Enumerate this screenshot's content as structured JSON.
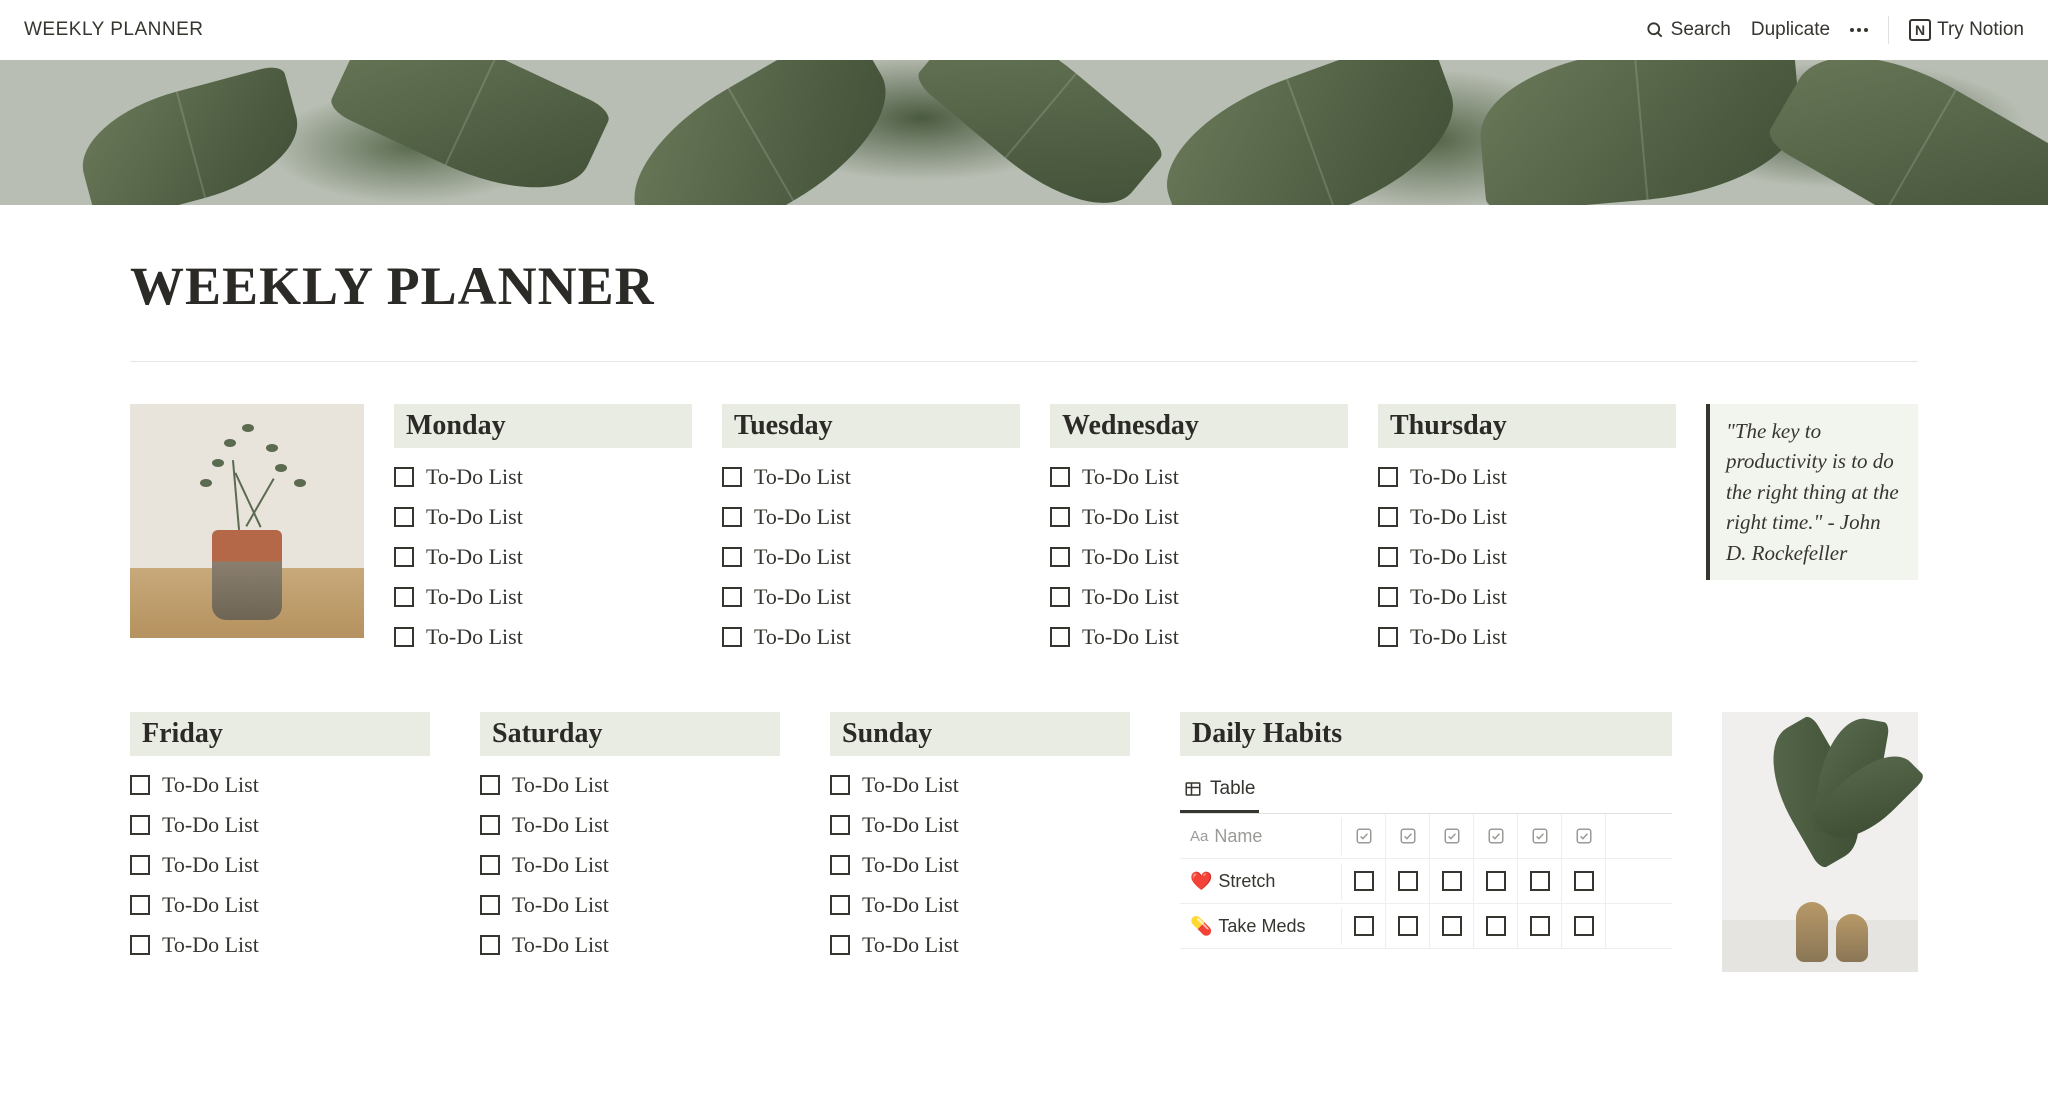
{
  "topbar": {
    "title": "WEEKLY PLANNER",
    "search": "Search",
    "duplicate": "Duplicate",
    "try_notion": "Try Notion"
  },
  "page_title": "WEEKLY PLANNER",
  "todo_label": "To-Do List",
  "days_row1": [
    "Monday",
    "Tuesday",
    "Wednesday",
    "Thursday"
  ],
  "days_row2": [
    "Friday",
    "Saturday",
    "Sunday"
  ],
  "quote": "\"The key to productivity is to do the right thing at the right time.\" - John D. Rockefeller",
  "habits": {
    "title": "Daily Habits",
    "tab_label": "Table",
    "name_header": "Name",
    "columns": 6,
    "rows": [
      {
        "emoji": "❤️",
        "name": "Stretch"
      },
      {
        "emoji": "💊",
        "name": "Take Meds"
      }
    ]
  }
}
